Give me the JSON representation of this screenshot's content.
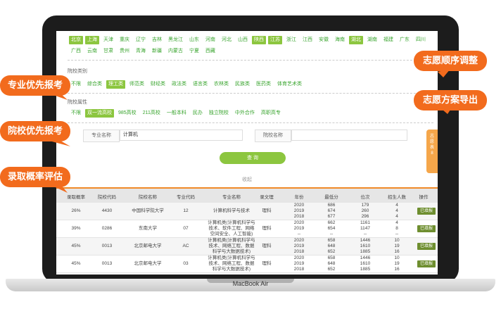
{
  "provinces": {
    "row1": [
      {
        "label": "北京",
        "selected": true
      },
      {
        "label": "上海",
        "selected": true
      },
      {
        "label": "天津",
        "selected": false
      },
      {
        "label": "重庆",
        "selected": false
      },
      {
        "label": "辽宁",
        "selected": false
      },
      {
        "label": "吉林",
        "selected": false
      },
      {
        "label": "黑龙江",
        "selected": false
      },
      {
        "label": "山东",
        "selected": false
      },
      {
        "label": "河南",
        "selected": false
      },
      {
        "label": "河北",
        "selected": false
      },
      {
        "label": "山西",
        "selected": false
      },
      {
        "label": "陕西",
        "selected": true
      },
      {
        "label": "江苏",
        "selected": true
      },
      {
        "label": "浙江",
        "selected": false
      },
      {
        "label": "江西",
        "selected": false
      },
      {
        "label": "安徽",
        "selected": false
      },
      {
        "label": "海南",
        "selected": false
      },
      {
        "label": "湖北",
        "selected": true
      },
      {
        "label": "湖南",
        "selected": false
      },
      {
        "label": "福建",
        "selected": false
      },
      {
        "label": "广东",
        "selected": false
      },
      {
        "label": "四川",
        "selected": false
      }
    ],
    "row2": [
      {
        "label": "广西",
        "selected": false
      },
      {
        "label": "云南",
        "selected": false
      },
      {
        "label": "甘肃",
        "selected": false
      },
      {
        "label": "贵州",
        "selected": false
      },
      {
        "label": "青海",
        "selected": false
      },
      {
        "label": "新疆",
        "selected": false
      },
      {
        "label": "内蒙古",
        "selected": false
      },
      {
        "label": "宁夏",
        "selected": false
      },
      {
        "label": "西藏",
        "selected": false
      }
    ]
  },
  "school_type": {
    "label": "院校类别",
    "items": [
      {
        "label": "不限",
        "selected": false
      },
      {
        "label": "综合类",
        "selected": false
      },
      {
        "label": "理工类",
        "selected": true
      },
      {
        "label": "师范类",
        "selected": false
      },
      {
        "label": "财经类",
        "selected": false
      },
      {
        "label": "政法类",
        "selected": false
      },
      {
        "label": "语言类",
        "selected": false
      },
      {
        "label": "农林类",
        "selected": false
      },
      {
        "label": "民族类",
        "selected": false
      },
      {
        "label": "医药类",
        "selected": false
      },
      {
        "label": "体育艺术类",
        "selected": false
      }
    ]
  },
  "school_attr": {
    "label": "院校属性",
    "items": [
      {
        "label": "不限",
        "selected": false
      },
      {
        "label": "双一流高校",
        "selected": true
      },
      {
        "label": "985高校",
        "selected": false
      },
      {
        "label": "211高校",
        "selected": false
      },
      {
        "label": "一般本科",
        "selected": false
      },
      {
        "label": "民办",
        "selected": false
      },
      {
        "label": "独立院校",
        "selected": false
      },
      {
        "label": "中外合作",
        "selected": false
      },
      {
        "label": "高职高专",
        "selected": false
      }
    ]
  },
  "search": {
    "major_label": "专业名称",
    "major_value": "计算机",
    "school_label": "院校名称",
    "school_value": "",
    "query_button": "查 询",
    "collapse": "收起"
  },
  "table": {
    "headers": [
      "录取概率",
      "院校代码",
      "院校名称",
      "专业代码",
      "专业名称",
      "录文理",
      "年份",
      "最低分",
      "位次",
      "招生人数",
      "操作"
    ],
    "rows": [
      {
        "prob": "26%",
        "code": "4430",
        "school": "中国科学院大学",
        "mcode": "12",
        "major": [
          "计算机科学与技术"
        ],
        "track": "理科",
        "years": [
          "2020",
          "2019",
          "2018"
        ],
        "scores": [
          "686",
          "674",
          "677"
        ],
        "ranks": [
          "179",
          "260",
          "296"
        ],
        "nums": [
          "4",
          "4",
          "4"
        ],
        "action": "已填报"
      },
      {
        "prob": "39%",
        "code": "0286",
        "school": "东南大学",
        "mcode": "07",
        "major": [
          "计算机类(计算机科学与",
          "技术、软件工程、网络",
          "空间安全、人工智能)"
        ],
        "track": "理科",
        "years": [
          "2020",
          "2019",
          "--"
        ],
        "scores": [
          "662",
          "654",
          "--"
        ],
        "ranks": [
          "1161",
          "1147",
          "--"
        ],
        "nums": [
          "4",
          "8",
          "--"
        ],
        "action": "已填报"
      },
      {
        "prob": "45%",
        "code": "0013",
        "school": "北京邮电大学",
        "mcode": "AC",
        "major": [
          "计算机类(计算机科学与",
          "技术、网络工程、数据",
          "科学与大数据技术)"
        ],
        "track": "理科",
        "years": [
          "2020",
          "2019",
          "2018"
        ],
        "scores": [
          "658",
          "648",
          "652"
        ],
        "ranks": [
          "1446",
          "1610",
          "1885"
        ],
        "nums": [
          "10",
          "19",
          "16"
        ],
        "action": "已填报"
      },
      {
        "prob": "45%",
        "code": "0013",
        "school": "北京邮电大学",
        "mcode": "03",
        "major": [
          "计算机类(计算机科学与",
          "技术、网络工程、数据",
          "科学与大数据技术)"
        ],
        "track": "理科",
        "years": [
          "2020",
          "2019",
          "2018"
        ],
        "scores": [
          "658",
          "648",
          "652"
        ],
        "ranks": [
          "1446",
          "1610",
          "1885"
        ],
        "nums": [
          "10",
          "19",
          "16"
        ],
        "action": "已填报"
      }
    ]
  },
  "callouts": {
    "major_first": "专业优先报考",
    "school_first": "院校优先报考",
    "probability": "录取概率评估",
    "order_adjust": "志愿顺序调整",
    "export": "志愿方案导出"
  },
  "side_tab": "志愿表 8",
  "laptop_label": "MacBook Air",
  "colors": {
    "accent": "#8cc63f",
    "link": "#3aa52f",
    "callout": "#f26b1d",
    "table_border": "#f08a28",
    "button_dark": "#6e8e2f"
  }
}
